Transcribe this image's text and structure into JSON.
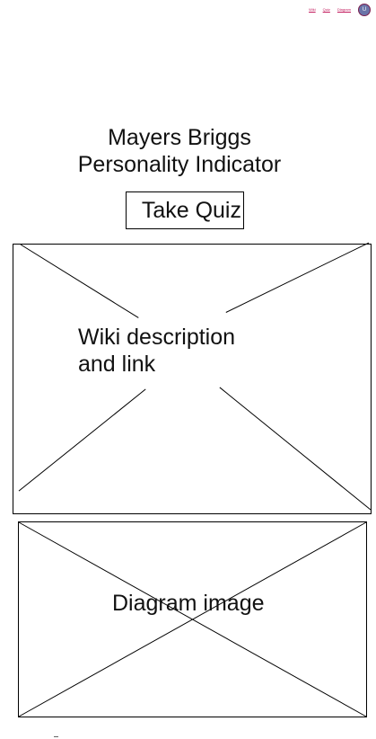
{
  "nav": {
    "link_1": "Wiki",
    "link_2": "Quiz",
    "link_3": "Diagram",
    "avatar_text": "U"
  },
  "title": {
    "line_1": "Mayers Briggs",
    "line_2": "Personality Indicator"
  },
  "quiz_button": {
    "label": "Take Quiz"
  },
  "wiki_section": {
    "line_1": "Wiki description",
    "line_2": "and link"
  },
  "diagram_section": {
    "label": "Diagram image"
  }
}
